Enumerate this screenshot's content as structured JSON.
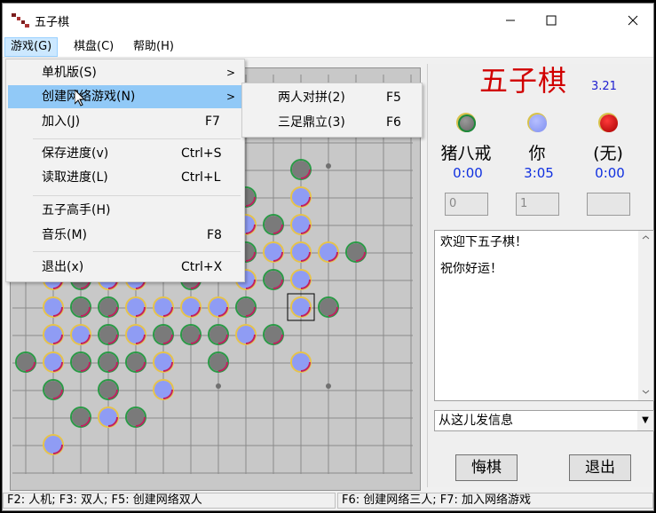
{
  "window": {
    "title": "五子棋"
  },
  "menubar": {
    "items": [
      "游戏(G)",
      "棋盘(C)",
      "帮助(H)"
    ]
  },
  "game_menu": {
    "items": [
      {
        "label": "单机版(S)",
        "shortcut": "",
        "submenu": true
      },
      {
        "label": "创建网络游戏(N)",
        "shortcut": "",
        "submenu": true,
        "highlighted": true
      },
      {
        "label": "加入(J)",
        "shortcut": "F7"
      },
      {
        "label": "保存进度(v)",
        "shortcut": "Ctrl+S"
      },
      {
        "label": "读取进度(L)",
        "shortcut": "Ctrl+L"
      },
      {
        "label": "五子高手(H)",
        "shortcut": ""
      },
      {
        "label": "音乐(M)",
        "shortcut": "F8"
      },
      {
        "label": "退出(x)",
        "shortcut": "Ctrl+X"
      }
    ]
  },
  "network_submenu": {
    "items": [
      {
        "label": "两人对拼(2)",
        "shortcut": "F5"
      },
      {
        "label": "三足鼎立(3)",
        "shortcut": "F6"
      }
    ]
  },
  "logo": {
    "text": "五子棋",
    "version": "3.21",
    "color": "#d10000"
  },
  "players": [
    {
      "name": "猪八戒",
      "time": "0:00",
      "stone": "gray",
      "score": "0"
    },
    {
      "name": "你",
      "time": "3:05",
      "stone": "blue",
      "score": "1"
    },
    {
      "name": "(无)",
      "time": "0:00",
      "stone": "red",
      "score": ""
    }
  ],
  "messages": [
    "欢迎下五子棋！",
    "祝你好运！"
  ],
  "send_input": {
    "placeholder": "从这儿发信息"
  },
  "buttons": {
    "undo": "悔棋",
    "exit": "退出"
  },
  "status": {
    "left": "F2: 人机; F3: 双人; F5: 创建网络双人",
    "right": "F6: 创建网络三人; F7: 加入网络游戏"
  },
  "colors": {
    "blue_stone": "#8f9cf4",
    "gray_stone": "#7a7a7a",
    "red_stone": "#cc0000",
    "board": "#c8c8c8"
  },
  "board": {
    "size": 15,
    "stones": [
      {
        "c": 10,
        "r": 0,
        "color": "gray"
      },
      {
        "c": 10,
        "r": 1,
        "color": "blue"
      },
      {
        "c": 8,
        "r": 1,
        "color": "gray"
      },
      {
        "c": 8,
        "r": 2,
        "color": "blue"
      },
      {
        "c": 9,
        "r": 2,
        "color": "gray"
      },
      {
        "c": 10,
        "r": 2,
        "color": "blue"
      },
      {
        "c": 8,
        "r": 3,
        "color": "gray"
      },
      {
        "c": 9,
        "r": 3,
        "color": "blue"
      },
      {
        "c": 10,
        "r": 3,
        "color": "blue"
      },
      {
        "c": 11,
        "r": 3,
        "color": "blue"
      },
      {
        "c": 12,
        "r": 3,
        "color": "gray"
      },
      {
        "c": 6,
        "r": 4,
        "color": "gray"
      },
      {
        "c": 8,
        "r": 4,
        "color": "blue"
      },
      {
        "c": 9,
        "r": 4,
        "color": "gray"
      },
      {
        "c": 10,
        "r": 4,
        "color": "blue"
      },
      {
        "c": 1,
        "r": 4,
        "color": "blue"
      },
      {
        "c": 2,
        "r": 4,
        "color": "gray"
      },
      {
        "c": 3,
        "r": 4,
        "color": "blue"
      },
      {
        "c": 4,
        "r": 4,
        "color": "blue"
      },
      {
        "c": 1,
        "r": 5,
        "color": "blue"
      },
      {
        "c": 2,
        "r": 5,
        "color": "gray"
      },
      {
        "c": 3,
        "r": 5,
        "color": "gray"
      },
      {
        "c": 4,
        "r": 5,
        "color": "blue"
      },
      {
        "c": 5,
        "r": 5,
        "color": "blue"
      },
      {
        "c": 6,
        "r": 5,
        "color": "blue"
      },
      {
        "c": 7,
        "r": 5,
        "color": "blue"
      },
      {
        "c": 8,
        "r": 5,
        "color": "gray"
      },
      {
        "c": 10,
        "r": 5,
        "color": "blue",
        "last": true
      },
      {
        "c": 11,
        "r": 5,
        "color": "gray"
      },
      {
        "c": 1,
        "r": 6,
        "color": "blue"
      },
      {
        "c": 2,
        "r": 6,
        "color": "blue"
      },
      {
        "c": 3,
        "r": 6,
        "color": "gray"
      },
      {
        "c": 4,
        "r": 6,
        "color": "blue"
      },
      {
        "c": 5,
        "r": 6,
        "color": "gray"
      },
      {
        "c": 6,
        "r": 6,
        "color": "gray"
      },
      {
        "c": 7,
        "r": 6,
        "color": "gray"
      },
      {
        "c": 8,
        "r": 6,
        "color": "blue"
      },
      {
        "c": 9,
        "r": 6,
        "color": "gray"
      },
      {
        "c": 0,
        "r": 7,
        "color": "gray"
      },
      {
        "c": 1,
        "r": 7,
        "color": "blue"
      },
      {
        "c": 2,
        "r": 7,
        "color": "gray"
      },
      {
        "c": 3,
        "r": 7,
        "color": "gray"
      },
      {
        "c": 4,
        "r": 7,
        "color": "gray"
      },
      {
        "c": 5,
        "r": 7,
        "color": "blue"
      },
      {
        "c": 7,
        "r": 7,
        "color": "gray"
      },
      {
        "c": 10,
        "r": 7,
        "color": "blue"
      },
      {
        "c": 1,
        "r": 8,
        "color": "gray"
      },
      {
        "c": 3,
        "r": 8,
        "color": "gray"
      },
      {
        "c": 5,
        "r": 8,
        "color": "blue"
      },
      {
        "c": 2,
        "r": 9,
        "color": "gray"
      },
      {
        "c": 3,
        "r": 9,
        "color": "blue"
      },
      {
        "c": 4,
        "r": 9,
        "color": "gray"
      },
      {
        "c": 1,
        "r": 10,
        "color": "blue"
      }
    ],
    "star_points": [
      [
        11,
        0
      ],
      [
        7,
        8
      ],
      [
        11,
        8
      ]
    ]
  }
}
